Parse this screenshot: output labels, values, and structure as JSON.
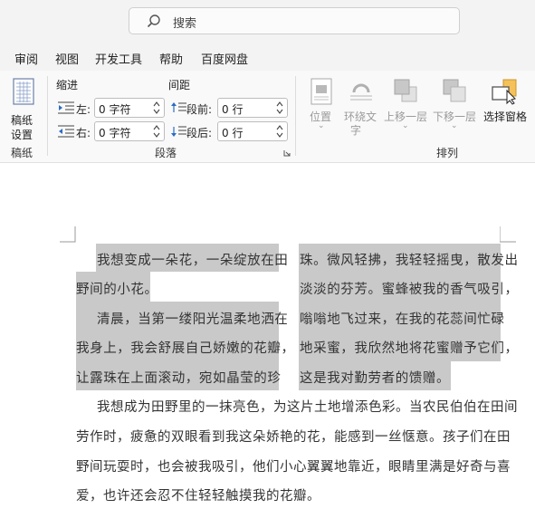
{
  "search": {
    "placeholder": "搜索"
  },
  "menu": {
    "tabs": [
      "审阅",
      "视图",
      "开发工具",
      "帮助",
      "百度网盘"
    ]
  },
  "ribbon": {
    "paper": {
      "button_label_1": "稿纸",
      "button_label_2": "设置",
      "group_label": "稿纸"
    },
    "paragraph": {
      "indent_label": "缩进",
      "spacing_label": "间距",
      "left_label": "左:",
      "right_label": "右:",
      "before_label": "段前:",
      "after_label": "段后:",
      "left_value": "0 字符",
      "right_value": "0 字符",
      "before_value": "0 行",
      "after_value": "0 行",
      "group_label": "段落"
    },
    "arrange": {
      "position": "位置",
      "wrap_1": "环绕文",
      "wrap_2": "字",
      "bring_forward": "上移一层",
      "send_backward": "下移一层",
      "selection_pane": "选择窗格",
      "group_label": "排列"
    }
  },
  "document": {
    "col1": [
      "我想变成一朵花，一朵绽放在田",
      "野间的小花。",
      "清晨，当第一缕阳光温柔地洒在",
      "我身上，我会舒展自己娇嫩的花瓣，",
      "让露珠在上面滚动，宛如晶莹的珍"
    ],
    "col2": [
      "珠。微风轻拂，我轻轻摇曳，散发出",
      "淡淡的芬芳。蜜蜂被我的香气吸引，",
      "嗡嗡地飞过来，在我的花蕊间忙碌",
      "地采蜜，我欣然地将花蜜赠予它们，",
      "这是我对勤劳者的馈赠。"
    ],
    "para": [
      "我想成为田野里的一抹亮色，为这片土地增添色彩。当农民伯伯在田间",
      "劳作时，疲惫的双眼看到我这朵娇艳的花，能感到一丝惬意。孩子们在田",
      "野间玩耍时，也会被我吸引，他们小心翼翼地靠近，眼睛里满是好奇与喜",
      "爱，也许还会忍不住轻轻触摸我的花瓣。"
    ]
  }
}
